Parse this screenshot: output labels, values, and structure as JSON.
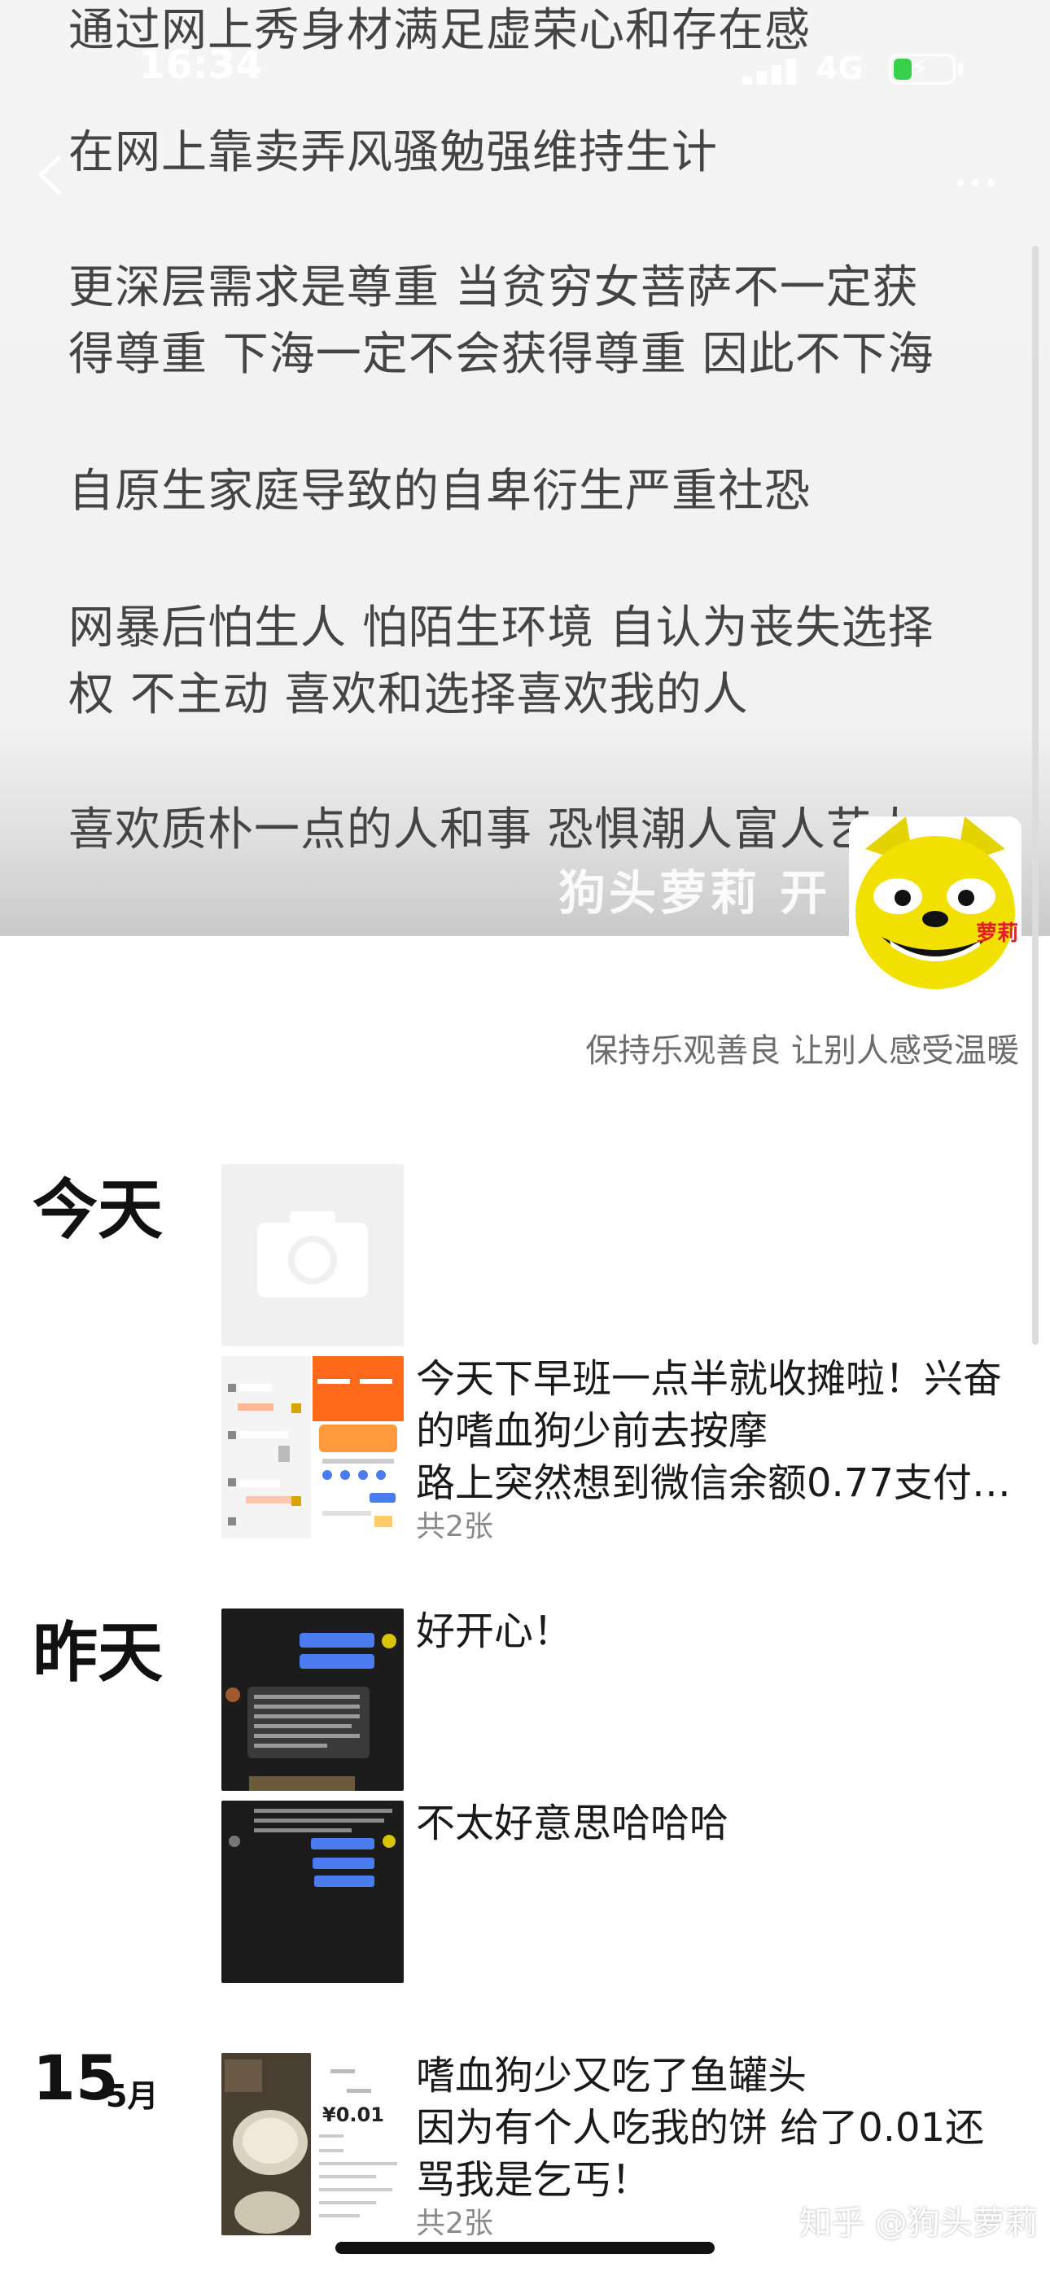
{
  "status_bar": {
    "time": "16:34",
    "network": "4G"
  },
  "cover": {
    "lines": [
      "通过网上秀身材满足虚荣心和存在感",
      "在网上靠卖弄风骚勉强维持生计",
      "更深层需求是尊重 当贫穷女菩萨不一定获",
      "得尊重 下海一定不会获得尊重 因此不下海",
      "自原生家庭导致的自卑衍生严重社恐",
      "网暴后怕生人 怕陌生环境 自认为丧失选择",
      "权 不主动 喜欢和选择喜欢我的人",
      "喜欢质朴一点的人和事 恐惧潮人富人艺人"
    ],
    "nickname": "狗头萝莉 开",
    "avatar_badge": "萝莉"
  },
  "profile": {
    "signature": "保持乐观善良 让别人感受温暖"
  },
  "feed": {
    "today": {
      "label": "今天",
      "post_lines": [
        "今天下早班一点半就收摊啦！兴奋",
        "的嗜血狗少前去按摩",
        "路上突然想到微信余额0.77支付…"
      ],
      "count": "共2张"
    },
    "yesterday": {
      "label": "昨天",
      "post1": "好开心！",
      "post2": "不太好意思哈哈哈"
    },
    "may15": {
      "day": "15",
      "month": "5月",
      "post_lines": [
        "嗜血狗少又吃了鱼罐头",
        "因为有个人吃我的饼 给了0.01还",
        "骂我是乞丐！"
      ],
      "count": "共2张",
      "thumb_amount": "¥0.01"
    }
  },
  "watermark": "知乎 @狗头萝莉",
  "colors": {
    "battery": "#39d14b",
    "chat_bubble_blue": "#4a7cf0",
    "app_orange": "#ff6a1a"
  }
}
